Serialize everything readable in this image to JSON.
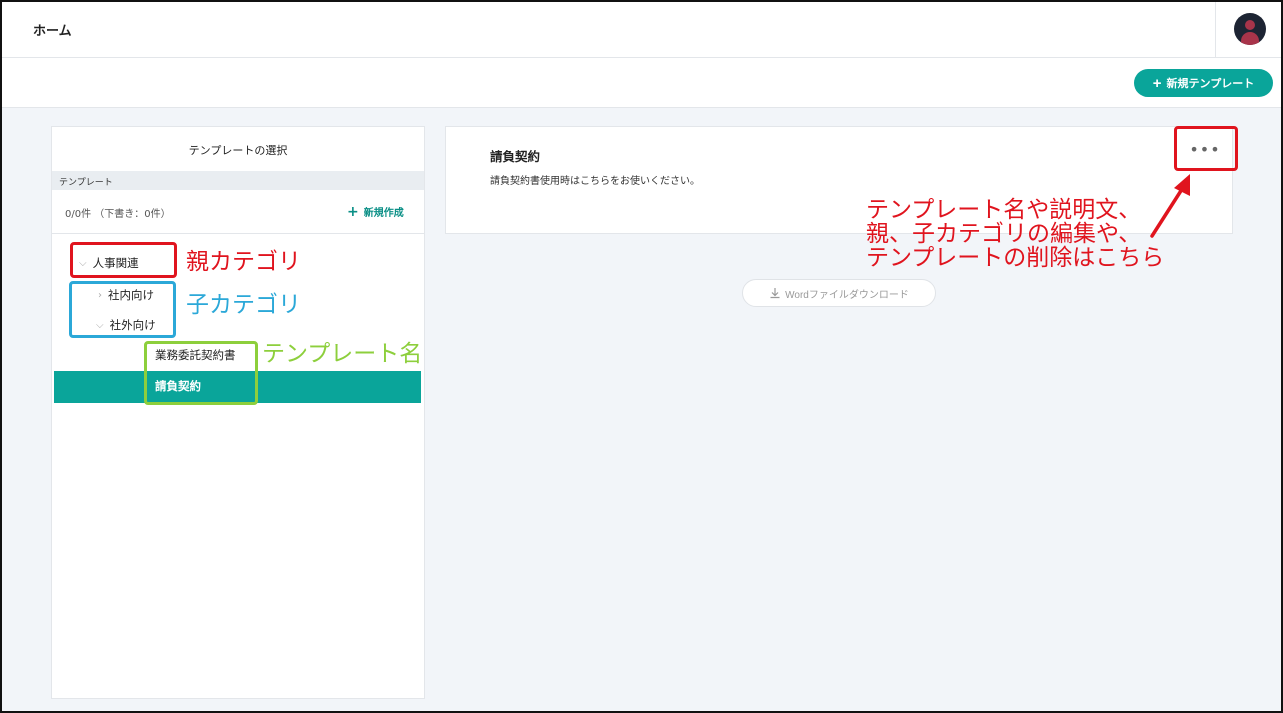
{
  "header": {
    "title": "ホーム",
    "avatar_icon": "user-avatar-icon"
  },
  "toolbar": {
    "new_template_label": "新規テンプレート"
  },
  "left_panel": {
    "title": "テンプレートの選択",
    "section_label": "テンプレート",
    "counts": "0/0件 （下書き：0件）",
    "new_create_label": "新規作成",
    "tree": {
      "parent": "人事関連",
      "child_internal": "社内向け",
      "child_external": "社外向け",
      "template_1": "業務委託契約書",
      "template_2": "請負契約"
    }
  },
  "detail": {
    "title": "請負契約",
    "description": "請負契約書使用時はこちらをお使いください。",
    "more_label": "•••",
    "download_label": "Wordファイルダウンロード"
  },
  "annotations": {
    "parent_category": "親カテゴリ",
    "child_category": "子カテゴリ",
    "template_name": "テンプレート名",
    "note_line1": "テンプレート名や説明文、",
    "note_line2": "親、子カテゴリの編集や、",
    "note_line3": "テンプレートの削除はこちら"
  },
  "colors": {
    "accent": "#0aa59a",
    "annotation_red": "#e0141e",
    "annotation_blue": "#2ba8d8",
    "annotation_green": "#8dcf3c"
  }
}
